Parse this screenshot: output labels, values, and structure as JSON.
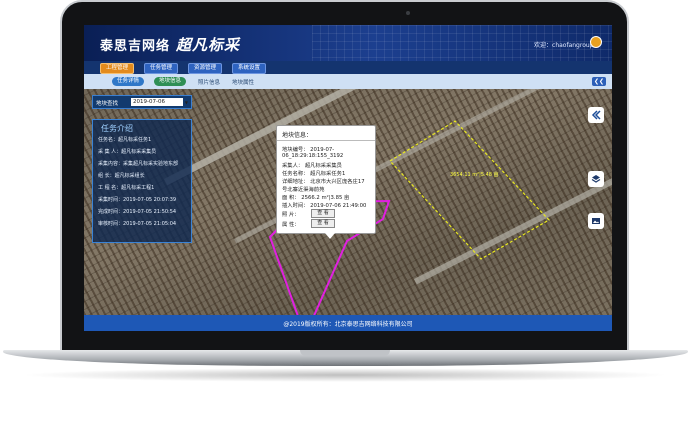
{
  "header": {
    "brand": "泰思吉网络",
    "slogan": "超凡标采",
    "welcome_label": "欢迎：",
    "username": "chaofangrouper"
  },
  "menu": {
    "items": [
      {
        "label": "工程管理",
        "active": true
      },
      {
        "label": "任务管理",
        "active": false
      },
      {
        "label": "资源管理",
        "active": false
      },
      {
        "label": "系统设置",
        "active": false
      }
    ]
  },
  "subnav": {
    "tab_task_detail": "任务详情",
    "tab_block_info": "地块信息",
    "link_photo_info": "照片信息",
    "link_block_attr": "地块属性"
  },
  "block_select": {
    "label": "地块查找",
    "value": "2019-07-06"
  },
  "task_panel": {
    "title": "任务介绍",
    "rows": [
      "任务名：超凡标采任务1",
      "采 集 人：超凡标采采集员",
      "采集内容：采集超凡标采实验地东部",
      "组 长：超凡标采组长",
      "工 程 名：超凡标采工程1",
      "采集时间：2019-07-05 20:07:39",
      "完成时间：2019-07-05 21:50:54",
      "审核时间：2019-07-05 21:05:04"
    ]
  },
  "popup": {
    "title": "地块信息：",
    "rows": [
      "地块编号：  2019-07-",
      "06_18:29:18:155_3192",
      "采集人：   超凡标采采集员",
      "任务名称：  超凡标采任务1",
      "详细地址：  北京市大兴区庞各庄17",
      "号北寨近渠海前苑",
      "面      积：  2566.2 m²|3.85 亩",
      "插入时间：  2019-07-06 21:49:00"
    ],
    "photo_label": "照      片：",
    "attr_label": "属      性：",
    "view_button": "查 看"
  },
  "map": {
    "area_label": "3654.11 m²|5.48 亩"
  },
  "footer": {
    "copyright": "@2019版权所有：北京泰思吉网络科技有限公司"
  },
  "colors": {
    "header_bg": "#1c3f8f",
    "active_menu": "#e38b1c",
    "footer_bg": "#1e58b6",
    "selected_block": "#e020e0",
    "other_block": "#e8e820"
  },
  "icons": [
    "collapse-icon",
    "layers-icon",
    "image-icon",
    "user-icon",
    "dropdown-arrow-icon"
  ]
}
